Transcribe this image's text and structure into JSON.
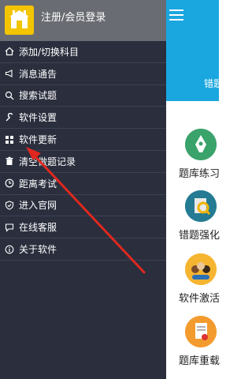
{
  "drawer": {
    "login_label": "注册/会员登录",
    "items": [
      {
        "label": "添加/切换科目",
        "icon": "home-icon"
      },
      {
        "label": "消息通告",
        "icon": "megaphone-icon"
      },
      {
        "label": "搜索试题",
        "icon": "search-icon"
      },
      {
        "label": "软件设置",
        "icon": "wrench-icon"
      },
      {
        "label": "软件更新",
        "icon": "grid-icon"
      },
      {
        "label": "清空做题记录",
        "icon": "trash-icon"
      },
      {
        "label": "距离考试",
        "icon": "clock-icon"
      },
      {
        "label": "进入官网",
        "icon": "shield-icon"
      },
      {
        "label": "在线客服",
        "icon": "chat-icon"
      },
      {
        "label": "关于软件",
        "icon": "info-icon"
      }
    ]
  },
  "main": {
    "header_text": "错题",
    "tiles": [
      {
        "label": "题库练习",
        "icon": "pen-icon"
      },
      {
        "label": "错题强化",
        "icon": "book-search-icon"
      },
      {
        "label": "软件激活",
        "icon": "users-icon"
      },
      {
        "label": "题库重载",
        "icon": "document-icon"
      }
    ]
  },
  "colors": {
    "drawer_bg": "#2a2e3d",
    "drawer_header_bg": "#6a6c73",
    "main_header_bg": "#1aa7e0",
    "arrow": "#e0281e"
  }
}
